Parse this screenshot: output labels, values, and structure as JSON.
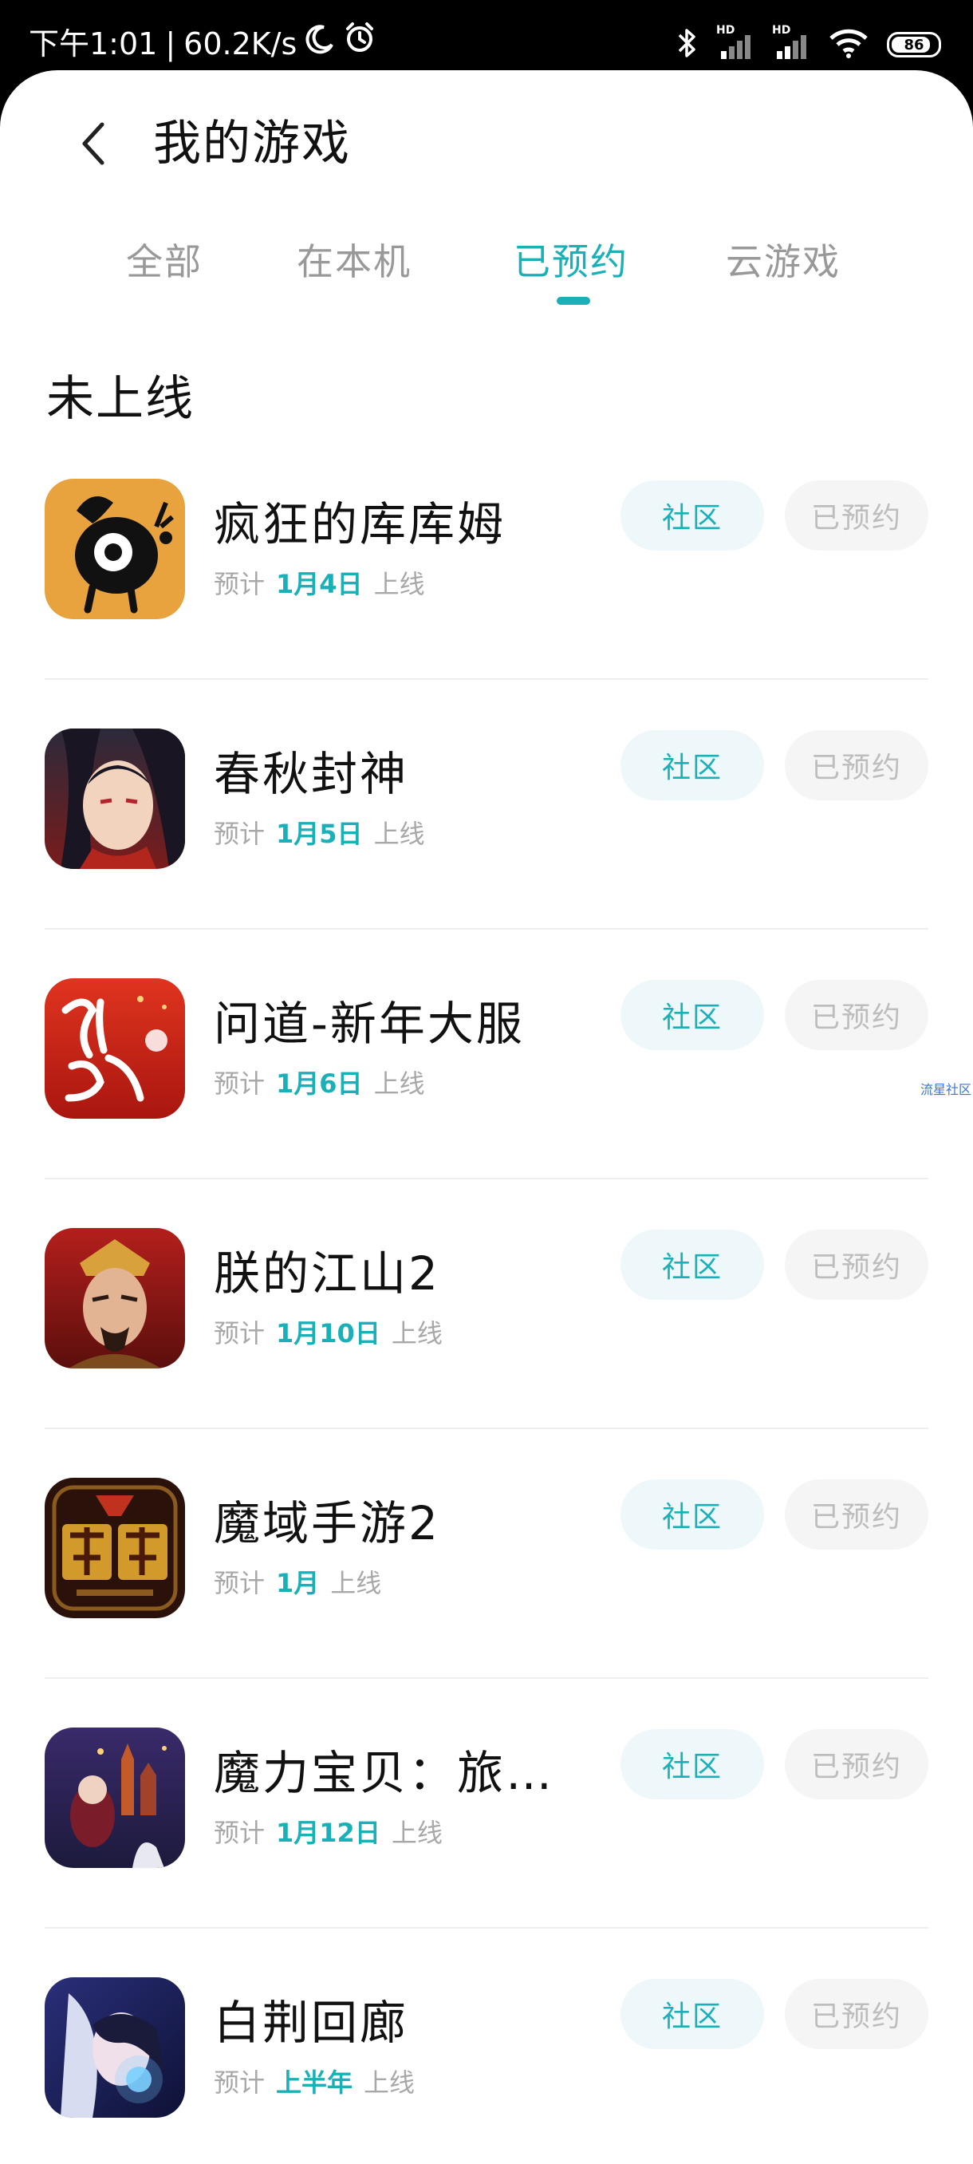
{
  "status_bar": {
    "time": "下午1:01",
    "separator": "|",
    "speed": "60.2K/s",
    "net1": "HD",
    "net2": "HD",
    "battery": "86",
    "battery_level": 0.86
  },
  "header": {
    "title": "我的游戏"
  },
  "tabs": [
    {
      "label": "全部",
      "active": false
    },
    {
      "label": "在本机",
      "active": false
    },
    {
      "label": "已预约",
      "active": true
    },
    {
      "label": "云游戏",
      "active": false
    }
  ],
  "section": {
    "title": "未上线"
  },
  "date_prefix": "预计",
  "date_suffix": "上线",
  "community_label": "社区",
  "reserved_label": "已预约",
  "games": [
    {
      "name": "疯狂的库库姆",
      "date": "1月4日"
    },
    {
      "name": "春秋封神",
      "date": "1月5日"
    },
    {
      "name": "问道-新年大服",
      "date": "1月6日"
    },
    {
      "name": "朕的江山2",
      "date": "1月10日"
    },
    {
      "name": "魔域手游2",
      "date": "1月"
    },
    {
      "name": "魔力宝贝：旅…",
      "date": "1月12日"
    },
    {
      "name": "白荆回廊",
      "date": "上半年"
    }
  ],
  "float_link": "流星社区",
  "colors": {
    "accent": "#1ab0b8",
    "community_bg": "#eef7fa",
    "reserved_bg": "#f5f5f5"
  }
}
